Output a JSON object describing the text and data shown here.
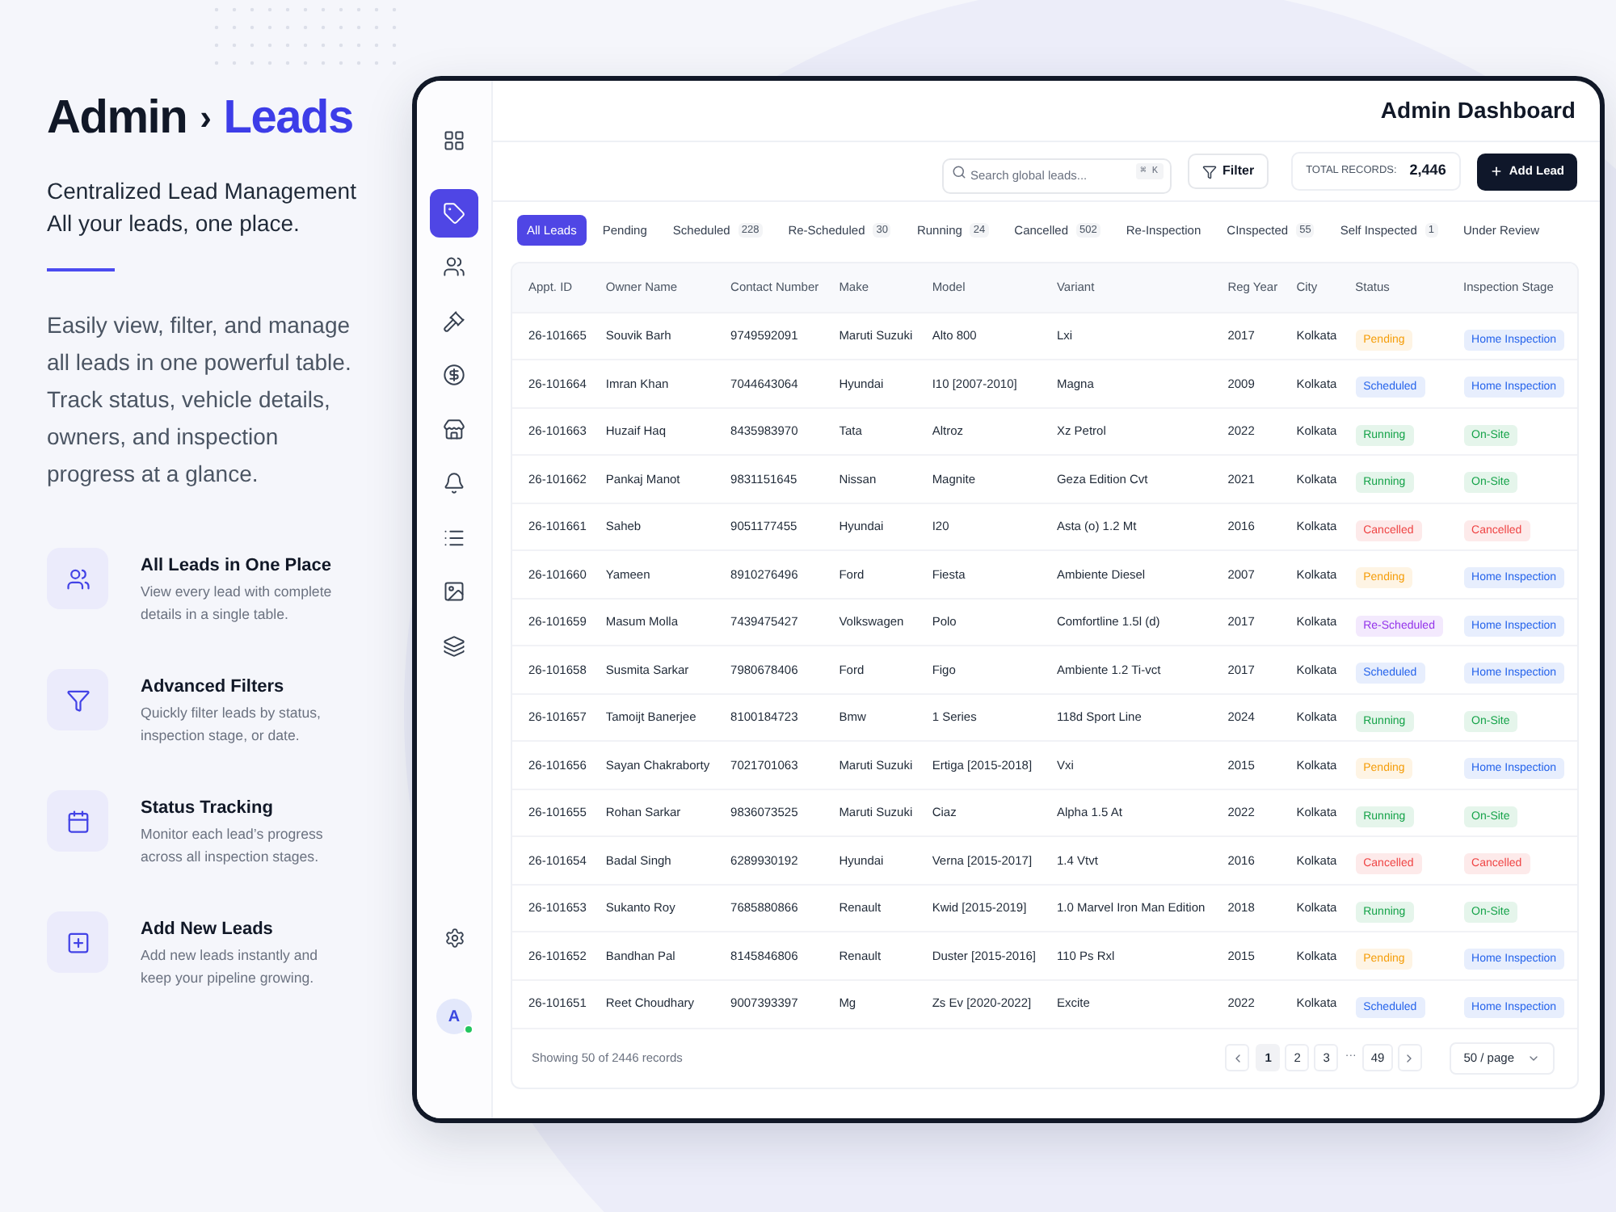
{
  "intro": {
    "breadcrumb": [
      {
        "label": "Admin",
        "selected": false
      },
      {
        "label": "Leads",
        "selected": true
      }
    ],
    "separator": "›",
    "tagline": [
      "Centralized Lead Management",
      "All your leads, one place."
    ],
    "description": "Easily view, filter, and manage all leads in one powerful table. Track status, vehicle details, owners, and inspection progress at a glance."
  },
  "features": [
    {
      "title": "All Leads in One Place",
      "text": "View every lead with complete details in a single table."
    },
    {
      "title": "Advanced Filters",
      "text": "Quickly filter leads by status, inspection stage, or date."
    },
    {
      "title": "Status Tracking",
      "text": "Monitor each lead’s progress across all inspection stages."
    },
    {
      "title": "Add New Leads",
      "text": "Add new leads instantly and keep your pipeline growing."
    }
  ],
  "sidebar": {
    "items": [
      {
        "selected": false
      },
      {
        "selected": true
      },
      {
        "selected": false
      },
      {
        "selected": false
      },
      {
        "selected": false
      },
      {
        "selected": false
      },
      {
        "selected": false
      },
      {
        "selected": false
      },
      {
        "selected": false
      },
      {
        "selected": false
      }
    ],
    "avatar": {
      "initial": "A",
      "online": true
    }
  },
  "header": {
    "title": "Admin Dashboard"
  },
  "toolbar": {
    "search": {
      "placeholder": "Search global leads...",
      "shortcut": "⌘ K"
    },
    "filter_button": "Filter",
    "total_records": {
      "label": "TOTAL RECORDS:",
      "value": "2,446"
    },
    "add_button": "Add Lead"
  },
  "tabs": [
    {
      "label": "All Leads",
      "selected": true
    },
    {
      "label": "Pending",
      "selected": false
    },
    {
      "label": "Scheduled",
      "count": "228",
      "selected": false
    },
    {
      "label": "Re-Scheduled",
      "count": "30",
      "selected": false
    },
    {
      "label": "Running",
      "count": "24",
      "selected": false
    },
    {
      "label": "Cancelled",
      "count": "502",
      "selected": false
    },
    {
      "label": "Re-Inspection",
      "selected": false
    },
    {
      "label": "CInspected",
      "count": "55",
      "selected": false
    },
    {
      "label": "Self Inspected",
      "count": "1",
      "selected": false
    },
    {
      "label": "Under Review",
      "selected": false
    }
  ],
  "table": {
    "columns": [
      "Appt. ID",
      "Owner Name",
      "Contact Number",
      "Make",
      "Model",
      "Variant",
      "Reg Year",
      "City",
      "Status",
      "Inspection Stage"
    ],
    "rows": [
      {
        "cells": [
          "26-101665",
          "Souvik Barh",
          "9749592091",
          "Maruti Suzuki",
          "Alto 800",
          "Lxi",
          "2017",
          "Kolkata"
        ],
        "status": {
          "label": "Pending",
          "color": "#f59e0b"
        },
        "stage": {
          "label": "Home Inspection",
          "color": "#2563eb"
        }
      },
      {
        "cells": [
          "26-101664",
          "Imran Khan",
          "7044643064",
          "Hyundai",
          "I10 [2007-2010]",
          "Magna",
          "2009",
          "Kolkata"
        ],
        "status": {
          "label": "Scheduled",
          "color": "#2563eb"
        },
        "stage": {
          "label": "Home Inspection",
          "color": "#2563eb"
        }
      },
      {
        "cells": [
          "26-101663",
          "Huzaif Haq",
          "8435983970",
          "Tata",
          "Altroz",
          "Xz Petrol",
          "2022",
          "Kolkata"
        ],
        "status": {
          "label": "Running",
          "color": "#16a34a"
        },
        "stage": {
          "label": "On-Site",
          "color": "#16a34a"
        }
      },
      {
        "cells": [
          "26-101662",
          "Pankaj Manot",
          "9831151645",
          "Nissan",
          "Magnite",
          "Geza Edition Cvt",
          "2021",
          "Kolkata"
        ],
        "status": {
          "label": "Running",
          "color": "#16a34a"
        },
        "stage": {
          "label": "On-Site",
          "color": "#16a34a"
        }
      },
      {
        "cells": [
          "26-101661",
          "Saheb",
          "9051177455",
          "Hyundai",
          "I20",
          "Asta (o) 1.2 Mt",
          "2016",
          "Kolkata"
        ],
        "status": {
          "label": "Cancelled",
          "color": "#ef4444"
        },
        "stage": {
          "label": "Cancelled",
          "color": "#ef4444"
        }
      },
      {
        "cells": [
          "26-101660",
          "Yameen",
          "8910276496",
          "Ford",
          "Fiesta",
          "Ambiente Diesel",
          "2007",
          "Kolkata"
        ],
        "status": {
          "label": "Pending",
          "color": "#f59e0b"
        },
        "stage": {
          "label": "Home Inspection",
          "color": "#2563eb"
        }
      },
      {
        "cells": [
          "26-101659",
          "Masum Molla",
          "7439475427",
          "Volkswagen",
          "Polo",
          "Comfortline 1.5l (d)",
          "2017",
          "Kolkata"
        ],
        "status": {
          "label": "Re-Scheduled",
          "color": "#9333ea"
        },
        "stage": {
          "label": "Home Inspection",
          "color": "#2563eb"
        }
      },
      {
        "cells": [
          "26-101658",
          "Susmita Sarkar",
          "7980678406",
          "Ford",
          "Figo",
          "Ambiente 1.2 Ti-vct",
          "2017",
          "Kolkata"
        ],
        "status": {
          "label": "Scheduled",
          "color": "#2563eb"
        },
        "stage": {
          "label": "Home Inspection",
          "color": "#2563eb"
        }
      },
      {
        "cells": [
          "26-101657",
          "Tamoijt Banerjee",
          "8100184723",
          "Bmw",
          "1 Series",
          "118d Sport Line",
          "2024",
          "Kolkata"
        ],
        "status": {
          "label": "Running",
          "color": "#16a34a"
        },
        "stage": {
          "label": "On-Site",
          "color": "#16a34a"
        }
      },
      {
        "cells": [
          "26-101656",
          "Sayan Chakraborty",
          "7021701063",
          "Maruti Suzuki",
          "Ertiga [2015-2018]",
          "Vxi",
          "2015",
          "Kolkata"
        ],
        "status": {
          "label": "Pending",
          "color": "#f59e0b"
        },
        "stage": {
          "label": "Home Inspection",
          "color": "#2563eb"
        }
      },
      {
        "cells": [
          "26-101655",
          "Rohan Sarkar",
          "9836073525",
          "Maruti Suzuki",
          "Ciaz",
          "Alpha 1.5 At",
          "2022",
          "Kolkata"
        ],
        "status": {
          "label": "Running",
          "color": "#16a34a"
        },
        "stage": {
          "label": "On-Site",
          "color": "#16a34a"
        }
      },
      {
        "cells": [
          "26-101654",
          "Badal Singh",
          "6289930192",
          "Hyundai",
          "Verna [2015-2017]",
          "1.4 Vtvt",
          "2016",
          "Kolkata"
        ],
        "status": {
          "label": "Cancelled",
          "color": "#ef4444"
        },
        "stage": {
          "label": "Cancelled",
          "color": "#ef4444"
        }
      },
      {
        "cells": [
          "26-101653",
          "Sukanto Roy",
          "7685880866",
          "Renault",
          "Kwid [2015-2019]",
          "1.0 Marvel Iron Man Edition",
          "2018",
          "Kolkata"
        ],
        "status": {
          "label": "Running",
          "color": "#16a34a"
        },
        "stage": {
          "label": "On-Site",
          "color": "#16a34a"
        }
      },
      {
        "cells": [
          "26-101652",
          "Bandhan Pal",
          "8145846806",
          "Renault",
          "Duster [2015-2016]",
          "110 Ps Rxl",
          "2015",
          "Kolkata"
        ],
        "status": {
          "label": "Pending",
          "color": "#f59e0b"
        },
        "stage": {
          "label": "Home Inspection",
          "color": "#2563eb"
        }
      },
      {
        "cells": [
          "26-101651",
          "Reet Choudhary",
          "9007393397",
          "Mg",
          "Zs Ev [2020-2022]",
          "Excite",
          "2022",
          "Kolkata"
        ],
        "status": {
          "label": "Scheduled",
          "color": "#2563eb"
        },
        "stage": {
          "label": "Home Inspection",
          "color": "#2563eb"
        }
      }
    ]
  },
  "footer": {
    "summary": "Showing 50 of 2446 records",
    "pages": [
      {
        "kind": "page",
        "label": "1",
        "selected": true
      },
      {
        "kind": "page",
        "label": "2",
        "selected": false
      },
      {
        "kind": "page",
        "label": "3",
        "selected": false
      },
      {
        "kind": "ellipsis",
        "label": "···"
      },
      {
        "kind": "page",
        "label": "49",
        "selected": false
      }
    ],
    "page_size": "50 / page"
  }
}
